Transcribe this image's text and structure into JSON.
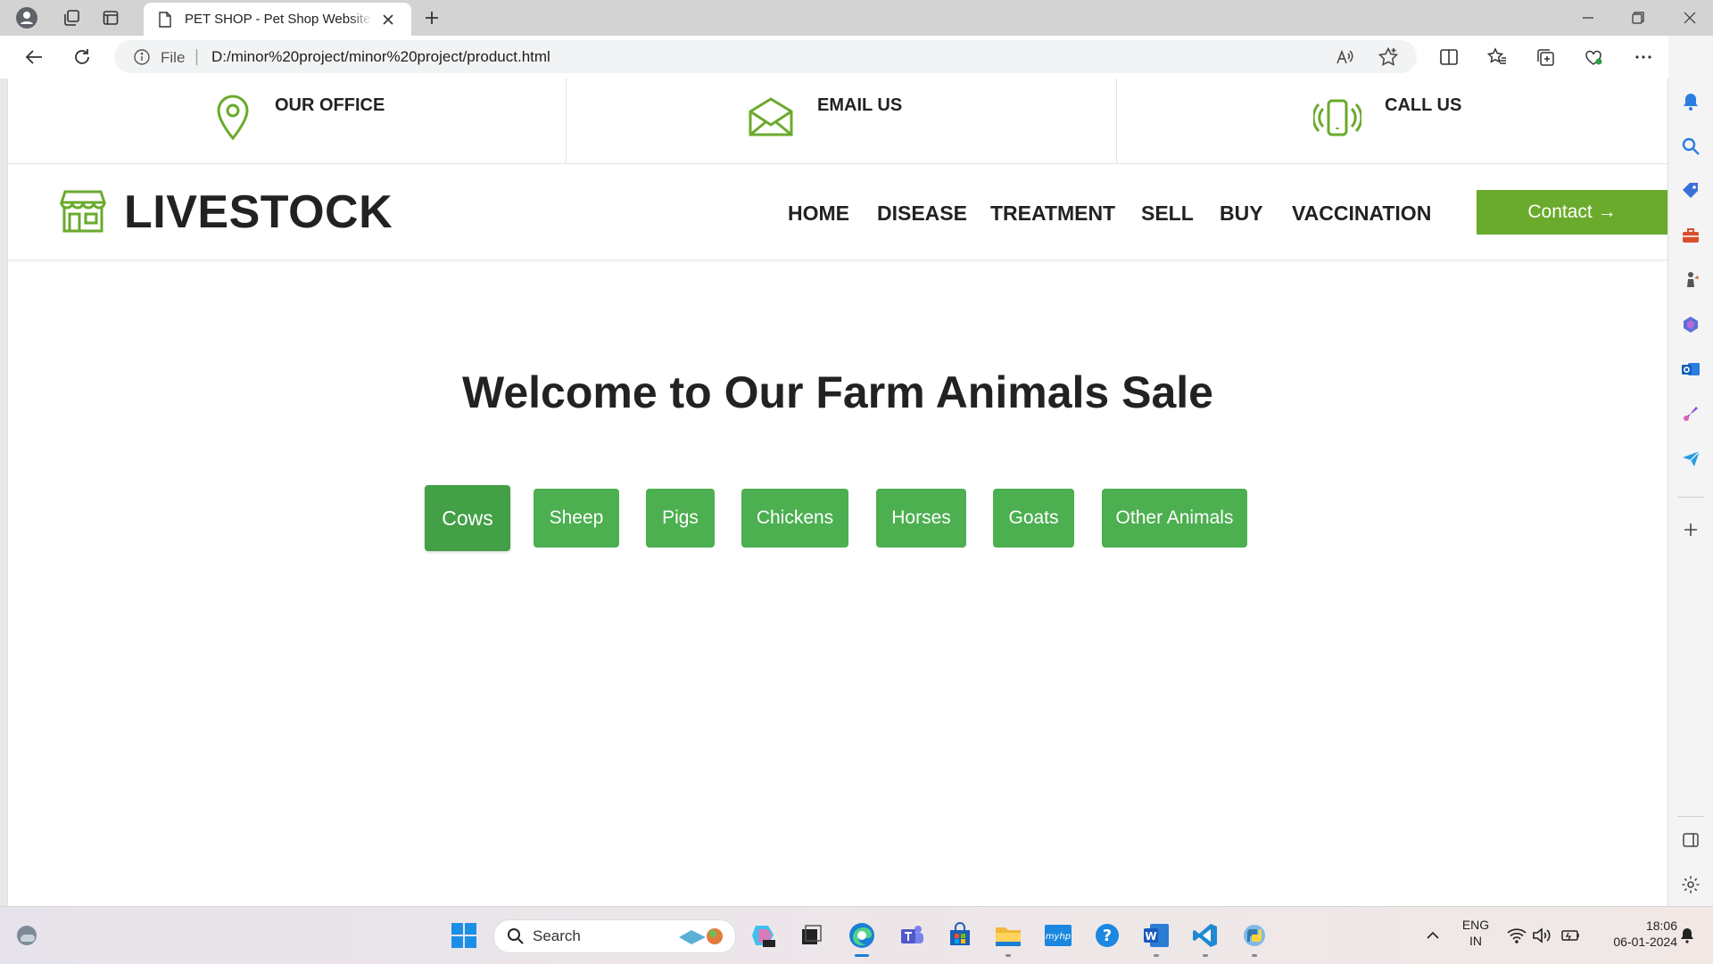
{
  "browser": {
    "tab_title": "PET SHOP - Pet Shop Website Template",
    "address_scheme": "File",
    "address_url": "D:/minor%20project/minor%20project/product.html"
  },
  "colors": {
    "accent_green": "#6aaa2c",
    "button_green": "#4caf50"
  },
  "infobar": [
    {
      "label": "OUR OFFICE",
      "icon": "location-pin-icon"
    },
    {
      "label": "EMAIL US",
      "icon": "envelope-icon"
    },
    {
      "label": "CALL US",
      "icon": "phone-vibrate-icon"
    }
  ],
  "brand": {
    "name": "LIVESTOCK",
    "icon": "store-icon"
  },
  "nav": [
    "HOME",
    "DISEASE",
    "TREATMENT",
    "SELL",
    "BUY",
    "VACCINATION"
  ],
  "contact_label": "Contact →",
  "headline": "Welcome to Our Farm Animals Sale",
  "categories": [
    "Cows",
    "Sheep",
    "Pigs",
    "Chickens",
    "Horses",
    "Goats",
    "Other Animals"
  ],
  "active_category": "Cows",
  "taskbar": {
    "search_label": "Search",
    "lang_line1": "ENG",
    "lang_line2": "IN",
    "time": "18:06",
    "date": "06-01-2024"
  }
}
